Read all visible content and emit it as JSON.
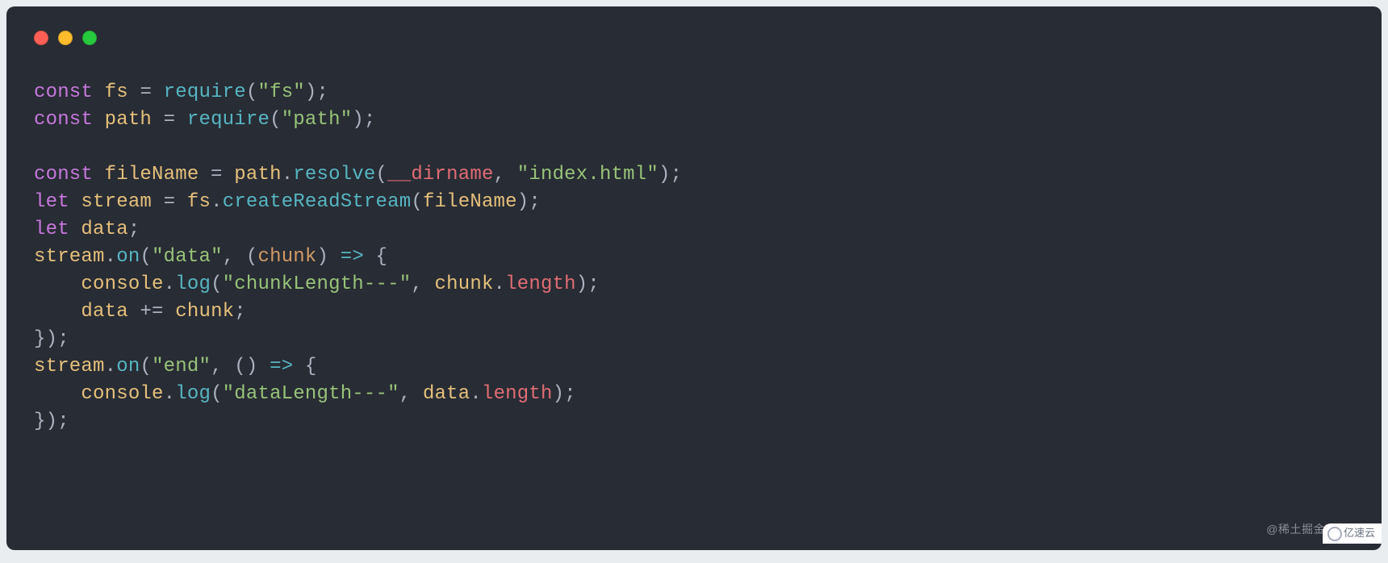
{
  "theme": {
    "bg": "#282c34",
    "fg": "#abb2bf",
    "red": "#ff5f56",
    "yellow": "#ffbd2e",
    "green": "#27c93f"
  },
  "code": {
    "tokens": [
      [
        {
          "t": "const ",
          "c": "kw"
        },
        {
          "t": "fs",
          "c": "id"
        },
        {
          "t": " = ",
          "c": "pn"
        },
        {
          "t": "require",
          "c": "fn"
        },
        {
          "t": "(",
          "c": "pn"
        },
        {
          "t": "\"fs\"",
          "c": "str"
        },
        {
          "t": ");",
          "c": "pn"
        }
      ],
      [
        {
          "t": "const ",
          "c": "kw"
        },
        {
          "t": "path",
          "c": "id"
        },
        {
          "t": " = ",
          "c": "pn"
        },
        {
          "t": "require",
          "c": "fn"
        },
        {
          "t": "(",
          "c": "pn"
        },
        {
          "t": "\"path\"",
          "c": "str"
        },
        {
          "t": ");",
          "c": "pn"
        }
      ],
      [],
      [
        {
          "t": "const ",
          "c": "kw"
        },
        {
          "t": "fileName",
          "c": "id"
        },
        {
          "t": " = ",
          "c": "pn"
        },
        {
          "t": "path",
          "c": "id"
        },
        {
          "t": ".",
          "c": "pn"
        },
        {
          "t": "resolve",
          "c": "fn"
        },
        {
          "t": "(",
          "c": "pn"
        },
        {
          "t": "__dirname",
          "c": "var"
        },
        {
          "t": ", ",
          "c": "pn"
        },
        {
          "t": "\"index.html\"",
          "c": "str"
        },
        {
          "t": ");",
          "c": "pn"
        }
      ],
      [
        {
          "t": "let ",
          "c": "kw"
        },
        {
          "t": "stream",
          "c": "id"
        },
        {
          "t": " = ",
          "c": "pn"
        },
        {
          "t": "fs",
          "c": "id"
        },
        {
          "t": ".",
          "c": "pn"
        },
        {
          "t": "createReadStream",
          "c": "fn"
        },
        {
          "t": "(",
          "c": "pn"
        },
        {
          "t": "fileName",
          "c": "id"
        },
        {
          "t": ");",
          "c": "pn"
        }
      ],
      [
        {
          "t": "let ",
          "c": "kw"
        },
        {
          "t": "data",
          "c": "id"
        },
        {
          "t": ";",
          "c": "pn"
        }
      ],
      [
        {
          "t": "stream",
          "c": "id"
        },
        {
          "t": ".",
          "c": "pn"
        },
        {
          "t": "on",
          "c": "fn"
        },
        {
          "t": "(",
          "c": "pn"
        },
        {
          "t": "\"data\"",
          "c": "str"
        },
        {
          "t": ", (",
          "c": "pn"
        },
        {
          "t": "chunk",
          "c": "arg"
        },
        {
          "t": ") ",
          "c": "pn"
        },
        {
          "t": "=>",
          "c": "op"
        },
        {
          "t": " {",
          "c": "pn"
        }
      ],
      [
        {
          "t": "    ",
          "c": "pn"
        },
        {
          "t": "console",
          "c": "id"
        },
        {
          "t": ".",
          "c": "pn"
        },
        {
          "t": "log",
          "c": "fn"
        },
        {
          "t": "(",
          "c": "pn"
        },
        {
          "t": "\"chunkLength---\"",
          "c": "str"
        },
        {
          "t": ", ",
          "c": "pn"
        },
        {
          "t": "chunk",
          "c": "id"
        },
        {
          "t": ".",
          "c": "pn"
        },
        {
          "t": "length",
          "c": "prop"
        },
        {
          "t": ");",
          "c": "pn"
        }
      ],
      [
        {
          "t": "    ",
          "c": "pn"
        },
        {
          "t": "data",
          "c": "id"
        },
        {
          "t": " += ",
          "c": "pn"
        },
        {
          "t": "chunk",
          "c": "id"
        },
        {
          "t": ";",
          "c": "pn"
        }
      ],
      [
        {
          "t": "});",
          "c": "pn"
        }
      ],
      [
        {
          "t": "stream",
          "c": "id"
        },
        {
          "t": ".",
          "c": "pn"
        },
        {
          "t": "on",
          "c": "fn"
        },
        {
          "t": "(",
          "c": "pn"
        },
        {
          "t": "\"end\"",
          "c": "str"
        },
        {
          "t": ", () ",
          "c": "pn"
        },
        {
          "t": "=>",
          "c": "op"
        },
        {
          "t": " {",
          "c": "pn"
        }
      ],
      [
        {
          "t": "    ",
          "c": "pn"
        },
        {
          "t": "console",
          "c": "id"
        },
        {
          "t": ".",
          "c": "pn"
        },
        {
          "t": "log",
          "c": "fn"
        },
        {
          "t": "(",
          "c": "pn"
        },
        {
          "t": "\"dataLength---\"",
          "c": "str"
        },
        {
          "t": ", ",
          "c": "pn"
        },
        {
          "t": "data",
          "c": "id"
        },
        {
          "t": ".",
          "c": "pn"
        },
        {
          "t": "length",
          "c": "prop"
        },
        {
          "t": ");",
          "c": "pn"
        }
      ],
      [
        {
          "t": "});",
          "c": "pn"
        }
      ]
    ]
  },
  "watermarks": {
    "juejin": "@稀土掘金",
    "yisu": "亿速云"
  }
}
